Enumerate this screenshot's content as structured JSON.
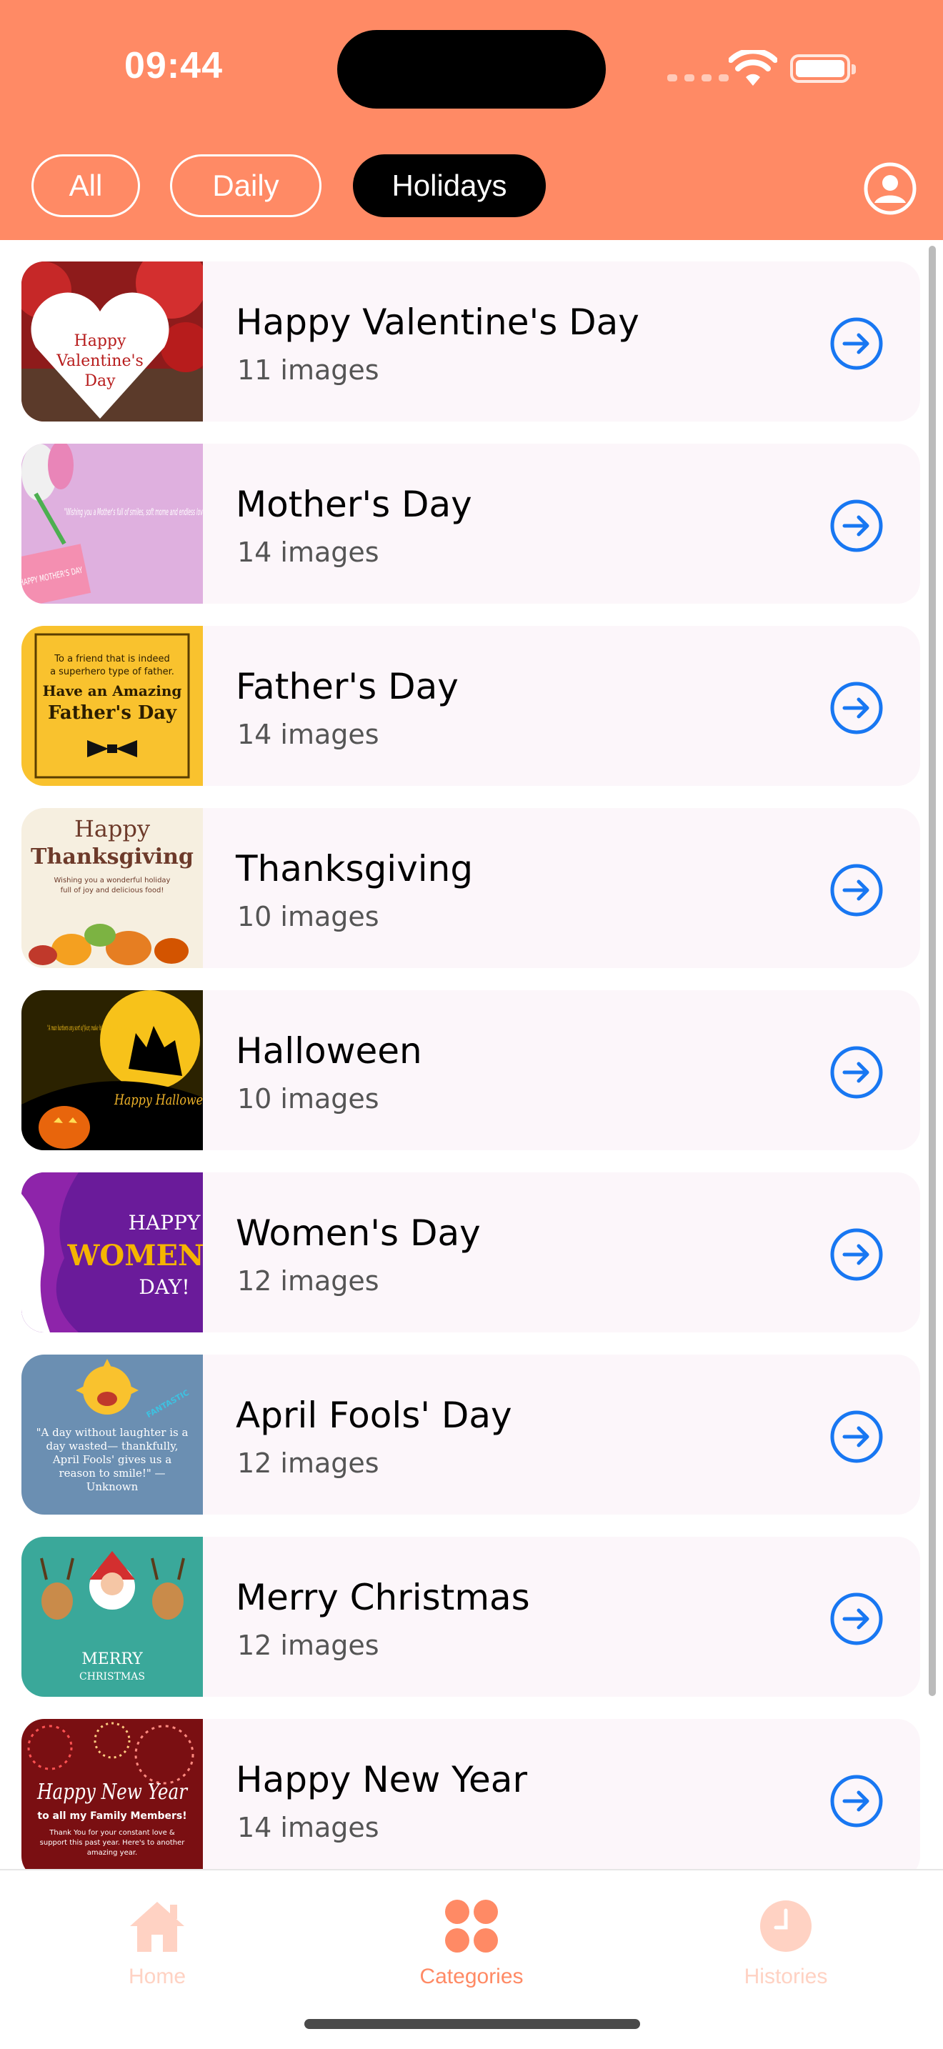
{
  "status_bar": {
    "time": "09:44"
  },
  "filters": [
    {
      "label": "All",
      "active": false
    },
    {
      "label": "Daily",
      "active": false
    },
    {
      "label": "Holidays",
      "active": true
    }
  ],
  "colors": {
    "header": "#FF8A65",
    "row_bg": "#FCF6FA",
    "arrow": "#1877F2",
    "tab_active": "#FF8A65",
    "tab_inactive": "#FFD2C3"
  },
  "holidays": [
    {
      "title": "Happy Valentine's Day",
      "count": "11 images"
    },
    {
      "title": "Mother's Day",
      "count": "14 images"
    },
    {
      "title": "Father's Day",
      "count": "14 images"
    },
    {
      "title": "Thanksgiving",
      "count": "10 images"
    },
    {
      "title": "Halloween",
      "count": "10 images"
    },
    {
      "title": "Women's Day",
      "count": "12 images"
    },
    {
      "title": "April Fools' Day",
      "count": "12 images"
    },
    {
      "title": "Merry Christmas",
      "count": "12 images"
    },
    {
      "title": "Happy New Year",
      "count": "14 images"
    }
  ],
  "thumbs": {
    "valentine": {
      "line1": "Happy",
      "line2": "Valentine's",
      "line3": "Day"
    },
    "mother": {
      "quote": "\"Wishing you a Mother's full of smiles, soft mome and endless love\"",
      "tag": "HAPPY MOTHER'S DAY"
    },
    "father": {
      "line1": "To a friend that is indeed",
      "line2": "a superhero type of father.",
      "line3": "Have an Amazing",
      "line4": "Father's Day"
    },
    "thanksgiving": {
      "line1": "Happy",
      "line2": "Thanksgiving",
      "line3": "Wishing you a wonderful holiday",
      "line4": "full of joy and delicious food!"
    },
    "halloween": {
      "quote": "\"A man harbors any sort of fear, make him landlord to a Ghost.\"",
      "text": "Happy Hallowe"
    },
    "women": {
      "line1": "HAPPY",
      "line2": "WOMEN",
      "line3": "DAY!"
    },
    "april": {
      "badge": "FANTASTIC",
      "quote": "\"A day without laughter is a day wasted— thankfully, April Fools' gives us a reason to smile!\" — Unknown"
    },
    "christmas": {
      "line1": "MERRY",
      "line2": "CHRISTMAS"
    },
    "newyear": {
      "line1": "Happy New Year",
      "line2": "to all my Family Members!",
      "line3": "Thank You for your constant love &",
      "line4": "support this past year. Here's to another",
      "line5": "amazing year."
    }
  },
  "tabs": [
    {
      "label": "Home",
      "icon": "house-icon",
      "active": false
    },
    {
      "label": "Categories",
      "icon": "grid-dots-icon",
      "active": true
    },
    {
      "label": "Histories",
      "icon": "clock-icon",
      "active": false
    }
  ]
}
